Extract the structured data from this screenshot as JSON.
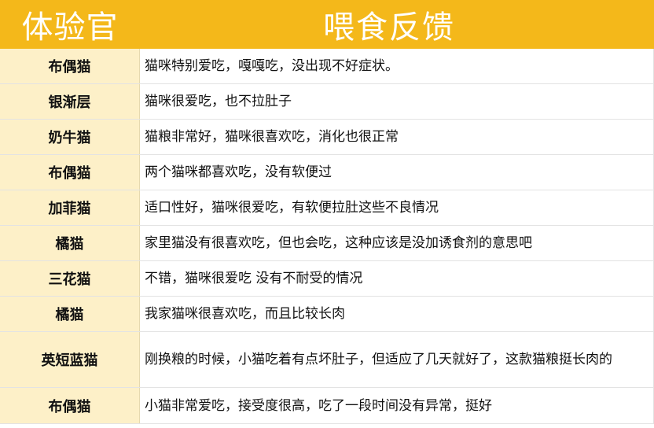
{
  "header": {
    "col1": "体验官",
    "col2": "喂食反馈"
  },
  "rows": [
    {
      "breed": "布偶猫",
      "feedback": "猫咪特别爱吃，嘎嘎吃，没出现不好症状。"
    },
    {
      "breed": "银渐层",
      "feedback": "猫咪很爱吃，也不拉肚子"
    },
    {
      "breed": "奶牛猫",
      "feedback": "猫粮非常好，猫咪很喜欢吃，消化也很正常"
    },
    {
      "breed": "布偶猫",
      "feedback": "两个猫咪都喜欢吃，没有软便过"
    },
    {
      "breed": "加菲猫",
      "feedback": "适口性好，猫咪很爱吃，有软便拉肚这些不良情况"
    },
    {
      "breed": "橘猫",
      "feedback": "家里猫没有很喜欢吃，但也会吃，这种应该是没加诱食剂的意思吧"
    },
    {
      "breed": "三花猫",
      "feedback": "不错，猫咪很爱吃 没有不耐受的情况"
    },
    {
      "breed": "橘猫",
      "feedback": "我家猫咪很喜欢吃，而且比较长肉"
    },
    {
      "breed": "英短蓝猫",
      "feedback": "刚换粮的时候，小猫吃着有点坏肚子，但适应了几天就好了，这款猫粮挺长肉的"
    },
    {
      "breed": "布偶猫",
      "feedback": "小猫非常爱吃，接受度很高，吃了一段时间没有异常，挺好"
    }
  ]
}
